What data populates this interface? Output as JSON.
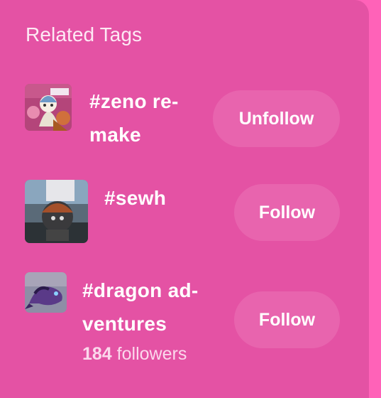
{
  "section": {
    "title": "Related Tags"
  },
  "tags": [
    {
      "line1": "#zeno re-",
      "line2": "make",
      "button": "Unfollow",
      "thumb_icon": "anime-character-thumbnail"
    },
    {
      "line1": "#sewh",
      "button": "Follow",
      "thumb_icon": "plush-toy-thumbnail"
    },
    {
      "line1": "#dragon ad-",
      "line2": "ventures",
      "followers_count": "184",
      "followers_label": "followers",
      "button": "Follow",
      "thumb_icon": "dragon-thumbnail"
    }
  ],
  "colors": {
    "panel": "#e452a4",
    "page": "#ff62b8",
    "button": "#e864ae",
    "text": "#ffffff"
  }
}
